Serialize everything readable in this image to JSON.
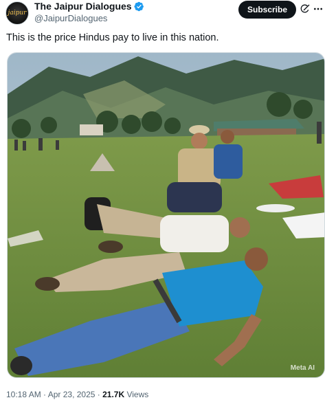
{
  "account": {
    "display_name": "The Jaipur Dialogues",
    "handle": "@JaipurDialogues",
    "avatar_text": "jaipur",
    "verified_icon": "verified-badge-icon"
  },
  "actions": {
    "subscribe_label": "Subscribe",
    "grok_icon": "grok-icon",
    "more_icon": "more-icon"
  },
  "tweet": {
    "text": "This is the price Hindus pay to live in this nation.",
    "media_watermark": "Meta AI"
  },
  "meta": {
    "time": "10:18 AM",
    "sep1": " · ",
    "date": "Apr 23, 2025",
    "sep2": " · ",
    "views_count": "21.7K",
    "views_label": " Views"
  },
  "colors": {
    "text_primary": "#0f1419",
    "text_secondary": "#536471",
    "verified_blue": "#1d9bf0",
    "button_dark": "#0f1419"
  }
}
